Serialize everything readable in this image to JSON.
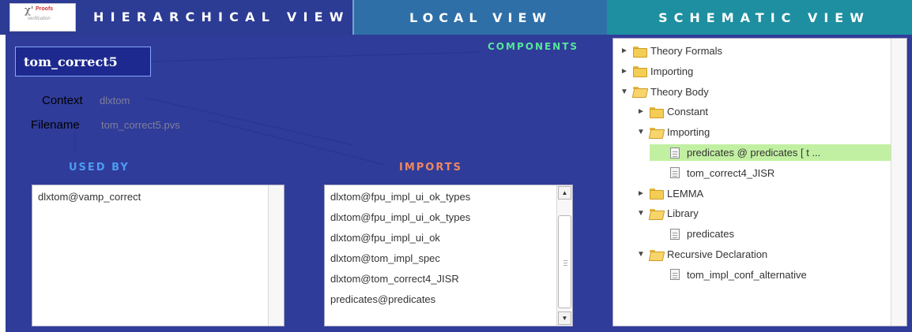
{
  "app": {
    "logo": {
      "mark": "χ'",
      "brand": "Proofs",
      "sub": "verification"
    }
  },
  "tabs": {
    "hierarchical": "HIERARCHICAL VIEW",
    "local": "LOCAL VIEW",
    "schematic": "SCHEMATIC VIEW"
  },
  "theory": {
    "name": "tom_correct5",
    "context_label": "Context",
    "context_value": "dlxtom",
    "filename_label": "Filename",
    "filename_value": "tom_correct5.pvs"
  },
  "used_by": {
    "title": "USED BY",
    "items": [
      "dlxtom@vamp_correct"
    ]
  },
  "imports": {
    "title": "IMPORTS",
    "items": [
      "dlxtom@fpu_impl_ui_ok_types",
      "dlxtom@fpu_impl_ui_ok_types",
      "dlxtom@fpu_impl_ui_ok",
      "dlxtom@tom_impl_spec",
      "dlxtom@tom_correct4_JISR",
      "predicates@predicates"
    ]
  },
  "components": {
    "title": "COMPONENTS",
    "tree": [
      {
        "label": "Theory Formals",
        "level": 0,
        "kind": "folder",
        "expanded": false
      },
      {
        "label": "Importing",
        "level": 0,
        "kind": "folder",
        "expanded": false
      },
      {
        "label": "Theory Body",
        "level": 0,
        "kind": "folder",
        "expanded": true
      },
      {
        "label": "Constant",
        "level": 1,
        "kind": "folder",
        "expanded": false
      },
      {
        "label": "Importing",
        "level": 1,
        "kind": "folder",
        "expanded": true
      },
      {
        "label": "predicates @ predicates [ t ...",
        "level": 2,
        "kind": "doc",
        "selected": true
      },
      {
        "label": "tom_correct4_JISR",
        "level": 2,
        "kind": "doc"
      },
      {
        "label": "LEMMA",
        "level": 1,
        "kind": "folder",
        "expanded": false
      },
      {
        "label": "Library",
        "level": 1,
        "kind": "folder",
        "expanded": true
      },
      {
        "label": "predicates",
        "level": 2,
        "kind": "doc"
      },
      {
        "label": "Recursive Declaration",
        "level": 1,
        "kind": "folder",
        "expanded": true
      },
      {
        "label": "tom_impl_conf_alternative",
        "level": 2,
        "kind": "doc"
      }
    ]
  },
  "colors": {
    "panel_bg": "#303c99",
    "used_by_title": "#4e9bf2",
    "imports_title": "#f0875f",
    "components_title": "#55e69a",
    "selection": "#c2f0a2"
  }
}
